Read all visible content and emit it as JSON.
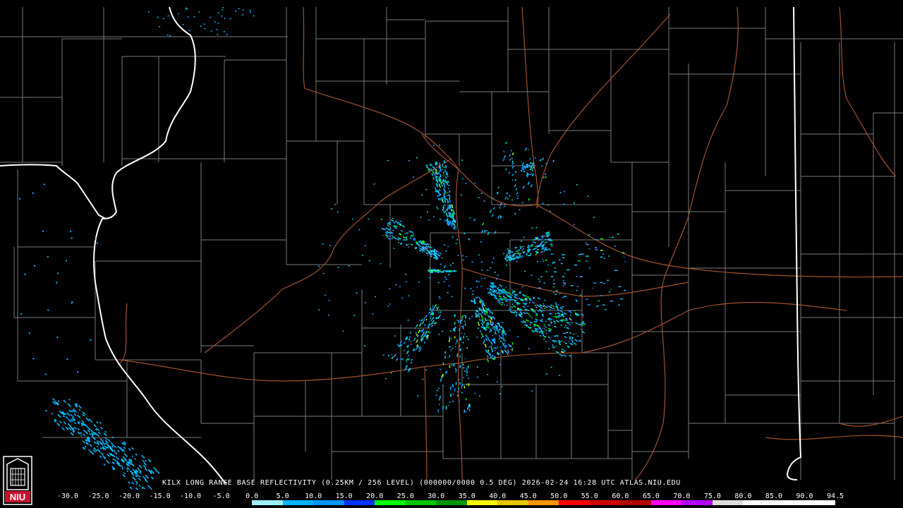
{
  "caption": "KILX LONG RANGE BASE REFLECTIVITY (0.25KM / 256 LEVEL) (000000/0000 0.5 DEG) 2026-02-24 16:28 UTC  ATLAS.NIU.EDU",
  "logo_text": "NIU",
  "colors": {
    "background": "#000000",
    "county_lines": "#7a7a7a",
    "state_lines": "#ffffff",
    "highways": "#a0522d",
    "logo_red": "#c8102e"
  },
  "scale": {
    "labels": [
      "-30.0",
      "-25.0",
      "-20.0",
      "-15.0",
      "-10.0",
      "-5.0",
      "0.0",
      "5.0",
      "10.0",
      "15.0",
      "20.0",
      "25.0",
      "30.0",
      "35.0",
      "40.0",
      "45.0",
      "50.0",
      "55.0",
      "60.0",
      "65.0",
      "70.0",
      "75.0",
      "80.0",
      "85.0",
      "90.0",
      "94.5"
    ],
    "colors": [
      "#000000",
      "#000000",
      "#000000",
      "#000000",
      "#000000",
      "#000000",
      "#9cf0ff",
      "#00b4ff",
      "#0096ff",
      "#0032ff",
      "#00ff00",
      "#00c800",
      "#009600",
      "#ffff00",
      "#e6c800",
      "#ff9600",
      "#ff0000",
      "#d20000",
      "#b40000",
      "#ff00ff",
      "#b400ff",
      "#dcdcdc",
      "#ffffff",
      "#ffffff",
      "#ffffff"
    ]
  }
}
